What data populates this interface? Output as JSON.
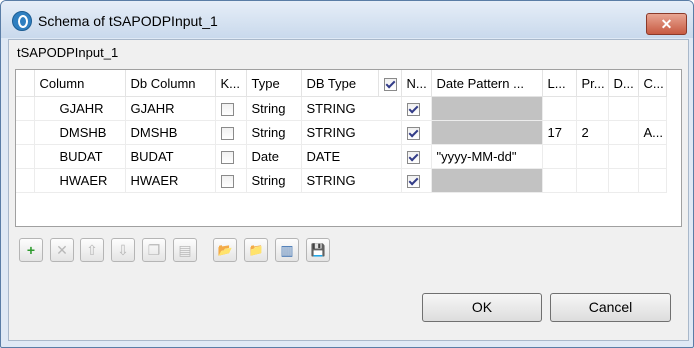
{
  "window": {
    "title": "Schema of tSAPODPInput_1"
  },
  "subtitle": "tSAPODPInput_1",
  "table": {
    "headers": [
      "Column",
      "Db Column",
      "K...",
      "Type",
      "DB Type",
      "N...",
      "Date Pattern ...",
      "L...",
      "Pr...",
      "D...",
      "C..."
    ],
    "rows": [
      {
        "column": "GJAHR",
        "db_column": "GJAHR",
        "key": false,
        "type": "String",
        "db_type": "STRING",
        "nullable": true,
        "date_pattern": "",
        "length": "",
        "precision": "",
        "default": "",
        "comment": ""
      },
      {
        "column": "DMSHB",
        "db_column": "DMSHB",
        "key": false,
        "type": "String",
        "db_type": "STRING",
        "nullable": true,
        "date_pattern": "",
        "length": "17",
        "precision": "2",
        "default": "",
        "comment": "A..."
      },
      {
        "column": "BUDAT",
        "db_column": "BUDAT",
        "key": false,
        "type": "Date",
        "db_type": "DATE",
        "nullable": true,
        "date_pattern": "\"yyyy-MM-dd\"",
        "length": "",
        "precision": "",
        "default": "",
        "comment": ""
      },
      {
        "column": "HWAER",
        "db_column": "HWAER",
        "key": false,
        "type": "String",
        "db_type": "STRING",
        "nullable": true,
        "date_pattern": "",
        "length": "",
        "precision": "",
        "default": "",
        "comment": ""
      }
    ]
  },
  "toolbar": {
    "buttons": [
      {
        "name": "add-icon",
        "glyph": "+",
        "enabled": true
      },
      {
        "name": "remove-icon",
        "glyph": "✕",
        "enabled": false
      },
      {
        "name": "move-up-icon",
        "glyph": "⇧",
        "enabled": false
      },
      {
        "name": "move-down-icon",
        "glyph": "⇩",
        "enabled": false
      },
      {
        "name": "copy-icon",
        "glyph": "❐",
        "enabled": false
      },
      {
        "name": "paste-icon",
        "glyph": "▤",
        "enabled": false
      },
      {
        "name": "import-icon",
        "glyph": "📂",
        "enabled": true
      },
      {
        "name": "export-icon",
        "glyph": "📁",
        "enabled": true
      },
      {
        "name": "reset-icon",
        "glyph": "▥",
        "enabled": true
      },
      {
        "name": "save-icon",
        "glyph": "💾",
        "enabled": true
      }
    ]
  },
  "buttons": {
    "ok": "OK",
    "cancel": "Cancel"
  }
}
